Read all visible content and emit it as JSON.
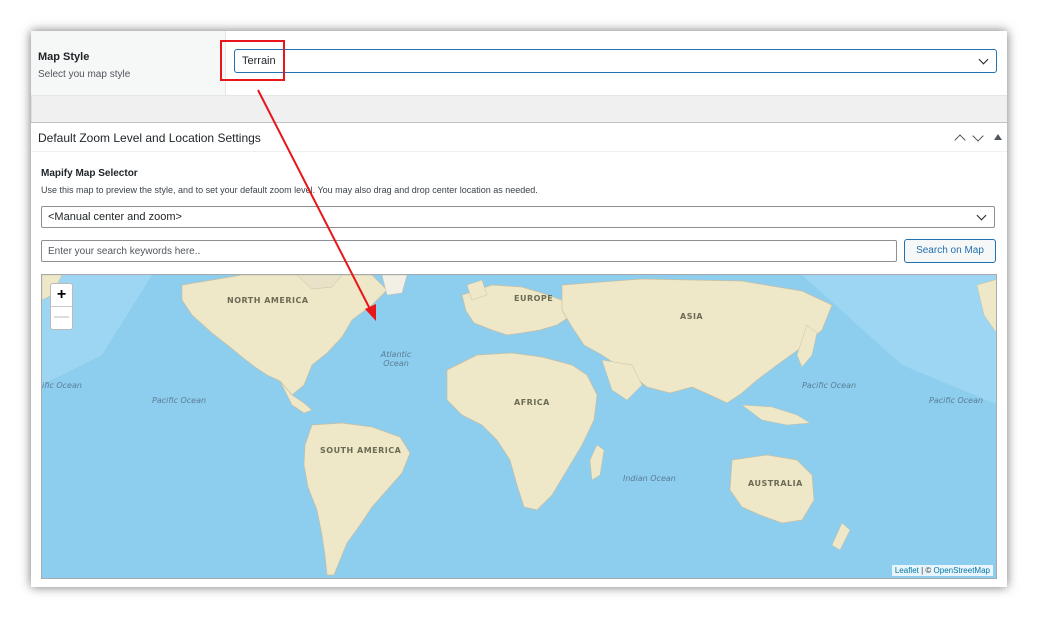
{
  "map_style": {
    "label": "Map Style",
    "description": "Select you map style",
    "selected": "Terrain"
  },
  "zoom_panel": {
    "title": "Default Zoom Level and Location Settings",
    "selector_title": "Mapify Map Selector",
    "selector_desc": "Use this map to preview the style, and to set your default zoom level. You may also drag and drop center location as needed.",
    "zoom_select_value": "<Manual center and zoom>",
    "search_placeholder": "Enter your search keywords here..",
    "search_button": "Search on Map"
  },
  "map": {
    "zoom_in": "+",
    "zoom_out": "—",
    "attribution_leaflet": "Leaflet",
    "attribution_sep": " | © ",
    "attribution_osm": "OpenStreetMap",
    "continents": {
      "north_america": "NORTH AMERICA",
      "south_america": "SOUTH AMERICA",
      "europe": "EUROPE",
      "asia": "ASIA",
      "africa": "AFRICA",
      "australia": "AUSTRALIA"
    },
    "oceans": {
      "atlantic_line1": "Atlantic",
      "atlantic_line2": "Ocean",
      "pacific_left": "Pacific Ocean",
      "pacific_edge_left": "ific Ocean",
      "pacific_right": "Pacific Ocean",
      "pacific_edge_right": "Pacific Ocean",
      "indian": "Indian Ocean"
    }
  },
  "colors": {
    "annotation_red": "#e8161b",
    "accent_blue": "#2271b1",
    "water": "#8dcdee",
    "land": "#efe8c8"
  }
}
